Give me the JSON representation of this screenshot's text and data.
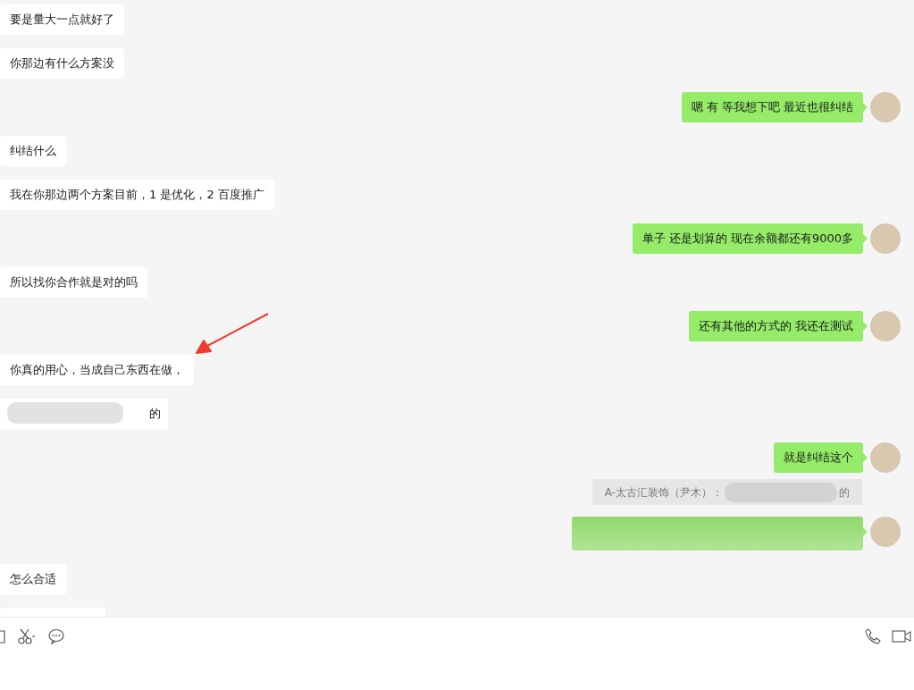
{
  "messages": [
    {
      "kind": "text",
      "outgoing": false,
      "text": "要是量大一点就好了"
    },
    {
      "kind": "text",
      "outgoing": false,
      "text": "你那边有什么方案没"
    },
    {
      "kind": "text",
      "outgoing": true,
      "text": "嗯 有 等我想下吧 最近也很纠结"
    },
    {
      "kind": "text",
      "outgoing": false,
      "text": "纠结什么"
    },
    {
      "kind": "text",
      "outgoing": false,
      "text": "我在你那边两个方案目前，1 是优化，2 百度推广"
    },
    {
      "kind": "text",
      "outgoing": true,
      "text": "单子 还是划算的 现在余额都还有9000多"
    },
    {
      "kind": "text",
      "outgoing": false,
      "text": "所以找你合作就是对的吗"
    },
    {
      "kind": "text",
      "outgoing": true,
      "text": "还有其他的方式的 我还在测试"
    },
    {
      "kind": "text",
      "outgoing": false,
      "text": "你真的用心，当成自己东西在做，",
      "arrow": true
    },
    {
      "kind": "blurred",
      "outgoing": false,
      "text": "的"
    },
    {
      "kind": "text",
      "outgoing": true,
      "text": "就是纠结这个"
    },
    {
      "kind": "quote",
      "outgoing": true,
      "text": "A-太古汇装饰（尹木）：",
      "tail": "的"
    },
    {
      "kind": "blurred",
      "outgoing": true
    },
    {
      "kind": "text",
      "outgoing": false,
      "text": "怎么合适"
    },
    {
      "kind": "cut",
      "outgoing": false
    }
  ]
}
